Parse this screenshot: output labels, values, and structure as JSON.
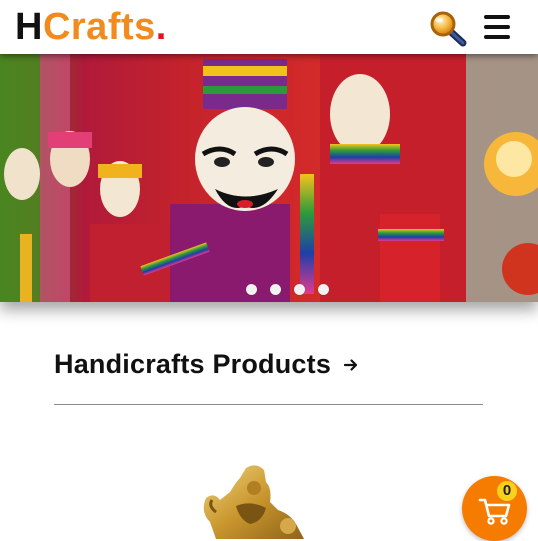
{
  "header": {
    "logo": {
      "first": "H",
      "rest": "Crafts",
      "dot": "."
    }
  },
  "hero": {
    "slides": [
      "puppets-image",
      "lanterns-image"
    ],
    "dot_count": 4
  },
  "section": {
    "title": "Handicrafts Products"
  },
  "cart": {
    "count": "0"
  },
  "colors": {
    "brand_orange": "#f28b1d",
    "logo_dot_red": "#e8111e",
    "cart_orange": "#f57c00",
    "badge_yellow": "#f9d11c"
  }
}
